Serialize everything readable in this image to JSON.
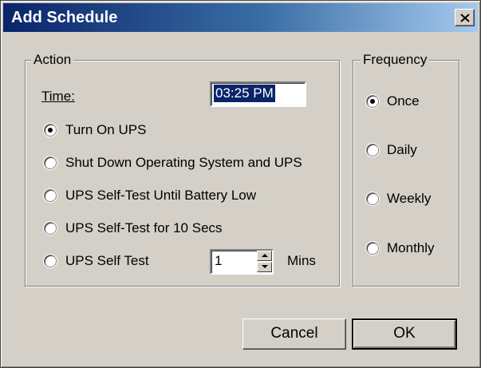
{
  "dialog": {
    "title": "Add Schedule"
  },
  "action": {
    "legend": "Action",
    "time_label": "Time:",
    "time_value": "03:25 PM",
    "options": [
      {
        "label": "Turn On UPS",
        "checked": true
      },
      {
        "label": "Shut Down Operating System and UPS",
        "checked": false
      },
      {
        "label": "UPS Self-Test Until Battery Low",
        "checked": false
      },
      {
        "label": "UPS Self-Test for 10 Secs",
        "checked": false
      },
      {
        "label": "UPS Self Test",
        "checked": false
      }
    ],
    "self_test_minutes": "1",
    "minutes_unit": "Mins"
  },
  "frequency": {
    "legend": "Frequency",
    "options": [
      {
        "label": "Once",
        "checked": true
      },
      {
        "label": "Daily",
        "checked": false
      },
      {
        "label": "Weekly",
        "checked": false
      },
      {
        "label": "Monthly",
        "checked": false
      }
    ]
  },
  "buttons": {
    "cancel": "Cancel",
    "ok": "OK"
  },
  "icons": {
    "close": "close-icon",
    "spin_up": "arrow-up-icon",
    "spin_down": "arrow-down-icon"
  },
  "colors": {
    "titlebar_start": "#0a246a",
    "titlebar_end": "#a6caf0",
    "face": "#d4d0c8",
    "selection": "#0a246a"
  }
}
